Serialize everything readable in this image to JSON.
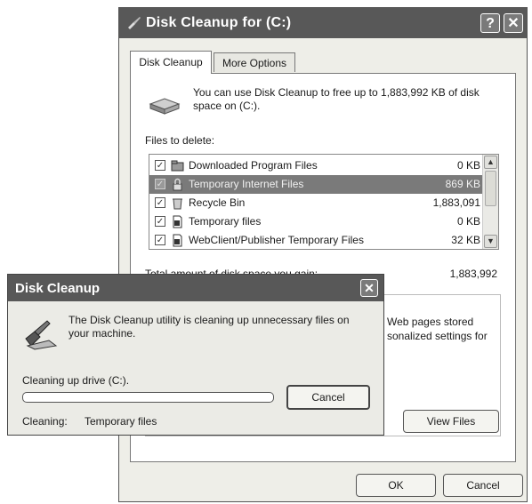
{
  "main_window": {
    "title": "Disk Cleanup for  (C:)",
    "help_glyph": "?",
    "close_glyph": "✕",
    "tabs": [
      {
        "label": "Disk Cleanup",
        "active": true
      },
      {
        "label": "More Options",
        "active": false
      }
    ],
    "intro_text": "You can use Disk Cleanup to free up to 1,883,992 KB of disk space on  (C:).",
    "files_label": "Files to delete:",
    "files": [
      {
        "name": "Downloaded Program Files",
        "size": "0 KB",
        "checked": true,
        "icon": "folder-icon"
      },
      {
        "name": "Temporary Internet Files",
        "size": "869 KB",
        "checked": true,
        "icon": "lock-icon",
        "selected": true
      },
      {
        "name": "Recycle Bin",
        "size": "1,883,091",
        "checked": true,
        "icon": "recycle-bin-icon"
      },
      {
        "name": "Temporary files",
        "size": "0 KB",
        "checked": true,
        "icon": "file-icon"
      },
      {
        "name": "WebClient/Publisher Temporary Files",
        "size": "32 KB",
        "checked": true,
        "icon": "file-icon"
      }
    ],
    "total_label": "Total amount of disk space you gain:",
    "total_value": "1,883,992",
    "description_line1": "Web pages stored",
    "description_line2": "sonalized settings for",
    "view_files_label": "View Files",
    "ok_label": "OK",
    "cancel_label": "Cancel"
  },
  "progress_dialog": {
    "title": "Disk Cleanup",
    "close_glyph": "✕",
    "message": "The Disk Cleanup utility is cleaning up unnecessary files on your machine.",
    "status": "Cleaning up drive  (C:).",
    "progress_fraction": 0,
    "cancel_label": "Cancel",
    "cleaning_label": "Cleaning:",
    "cleaning_value": "Temporary files"
  },
  "colors": {
    "titlebar": "#585858",
    "window_bg": "#eeeee8",
    "selection": "#7a7a7a"
  }
}
